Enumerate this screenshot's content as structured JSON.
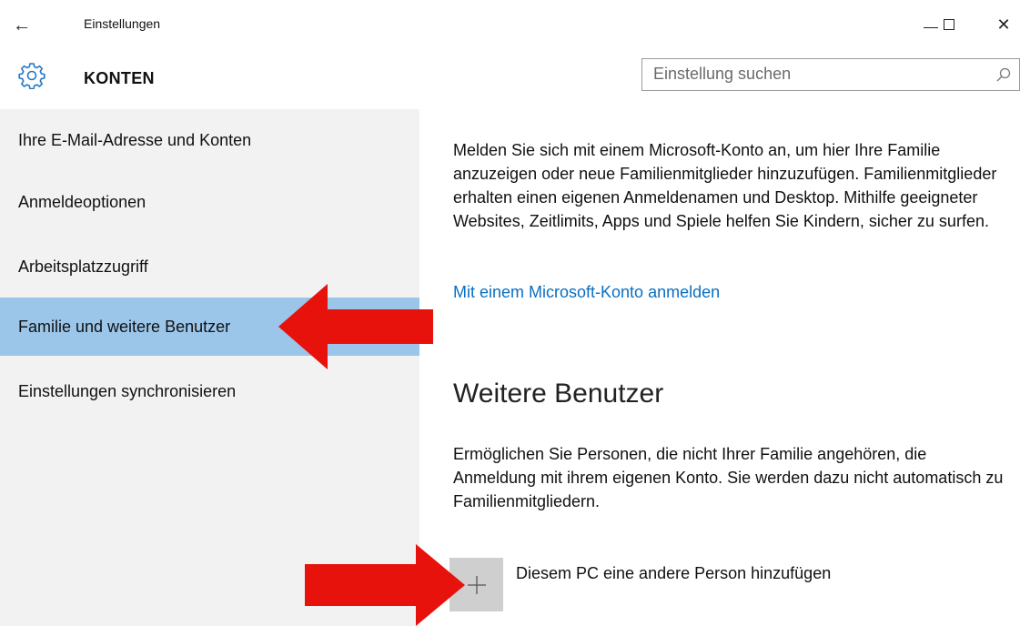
{
  "window": {
    "back_glyph": "←",
    "title": "Einstellungen",
    "controls": [
      "minimize-icon",
      "maximize-icon",
      "close-icon"
    ],
    "close_glyph": "✕"
  },
  "header": {
    "icon": "gear-icon",
    "title": "KONTEN",
    "search": {
      "placeholder": "Einstellung suchen",
      "value": "",
      "icon": "search-icon"
    }
  },
  "sidebar": {
    "items": [
      {
        "label": "Ihre E-Mail-Adresse und Konten",
        "active": false
      },
      {
        "label": "Anmeldeoptionen",
        "active": false
      },
      {
        "label": "Arbeitsplatzzugriff",
        "active": false
      },
      {
        "label": "Familie und weitere Benutzer",
        "active": true
      },
      {
        "label": "Einstellungen synchronisieren",
        "active": false
      }
    ]
  },
  "content": {
    "intro": "Melden Sie sich mit einem Microsoft-Konto an, um hier Ihre Familie anzuzeigen oder neue Familienmitglieder hinzuzufügen. Familienmitglieder erhalten einen eigenen Anmeldenamen und Desktop. Mithilfe geeigneter Websites, Zeitlimits, Apps und Spiele helfen Sie Kindern, sicher zu surfen.",
    "signin_link": "Mit einem Microsoft-Konto anmelden",
    "other_users_heading": "Weitere Benutzer",
    "other_users_desc": "Ermöglichen Sie Personen, die nicht Ihrer Familie angehören, die Anmeldung mit ihrem eigenen Konto. Sie werden dazu nicht automatisch zu Familienmitgliedern.",
    "add_person_label": "Diesem PC eine andere Person hinzufügen",
    "add_icon": "plus-icon"
  },
  "colors": {
    "accent_selected": "#9bc6ea",
    "link": "#0a6fc2",
    "annotation_arrow": "#e8120c",
    "sidebar_bg": "#f2f2f2"
  }
}
